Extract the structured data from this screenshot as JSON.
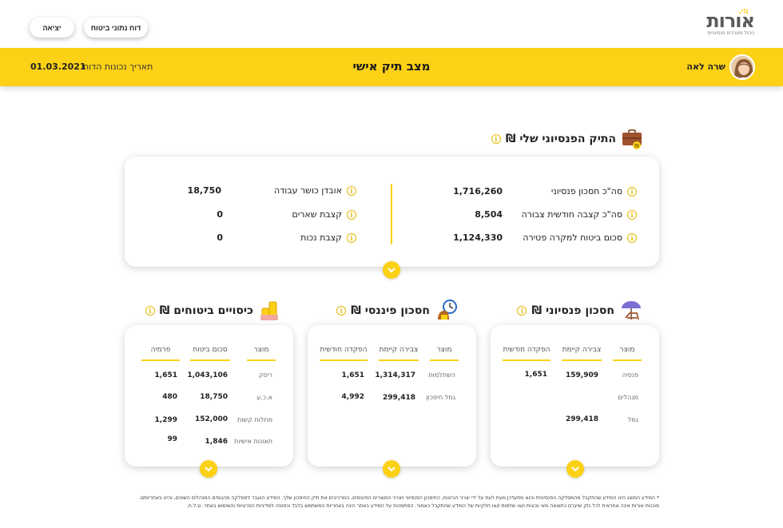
{
  "brand": {
    "name": "אורות",
    "tagline": "ניהול מערכים פנסיוניים"
  },
  "header_buttons": {
    "insurance_report": "דוח נתוני ביטוח",
    "exit": "יציאה"
  },
  "hero": {
    "title": "מצב תיק אישי",
    "user_name": "שרה לאה",
    "date_label": "תאריך נכונות הדוח",
    "date_value": "01.03.2021"
  },
  "summary": {
    "title": "התיק הפנסיוני שלי ₪",
    "right": [
      {
        "label": "סה\"כ חסכון פנסיוני",
        "value": "1,716,260"
      },
      {
        "label": "סה\"כ קצבה חודשית צבורה",
        "value": "8,504"
      },
      {
        "label": "סכום ביטוח למקרה פטירה",
        "value": "1,124,330"
      }
    ],
    "left": [
      {
        "label": "אובדן כושר עבודה",
        "value": "18,750"
      },
      {
        "label": "קצבת שארים",
        "value": "0"
      },
      {
        "label": "קצבת נכות",
        "value": "0"
      }
    ]
  },
  "pension": {
    "title": "חסכון פנסיוני ₪",
    "headers": [
      "מוצר",
      "צבירה קיימת",
      "הפקדה חודשית"
    ],
    "rows": [
      {
        "product": "פנסיה",
        "balance": "159,909",
        "monthly": "1,651"
      },
      {
        "product": "מנהלים",
        "balance": "",
        "monthly": ""
      },
      {
        "product": "גמל",
        "balance": "299,418",
        "monthly": ""
      }
    ]
  },
  "financial": {
    "title": "חסכון פיננסי ₪",
    "headers": [
      "מוצר",
      "צבירה קיימת",
      "הפקדה חודשית"
    ],
    "rows": [
      {
        "product": "השתלמות",
        "balance": "1,314,317",
        "monthly": "1,651"
      },
      {
        "product": "גמל חיסכון",
        "balance": "299,418",
        "monthly": "4,992"
      }
    ]
  },
  "insurance": {
    "title": "כיסויים ביטוחים ₪",
    "headers": [
      "מוצר",
      "סכום ביטוח",
      "פרמיה"
    ],
    "rows": [
      {
        "product": "ריסק",
        "sum": "1,043,106",
        "premium": "1,651"
      },
      {
        "product": "א.כ.ע",
        "sum": "18,750",
        "premium": "480"
      },
      {
        "product": "מחלות קשות",
        "sum": "152,000",
        "premium": "1,299"
      },
      {
        "product": "תאונות אישיות",
        "sum": "1,846",
        "premium": "99"
      }
    ]
  },
  "footnote": "* המידע המוצג הינו המידע שהתקבל מהמסלקה הפנסיונית והוא מתעדכן מעת לעת על ידי יצרני הביטוח, החיסכון הפנסיוני ויצרני המוצרים הפיננסים, המרכיבים את תיק החיסכון שלך. המידע הועבר למסלקה מהגופים המנהלים השונים, והינו באחריותם. סוכנות אורות אינה אחראית לכל נזק שייגרם כתוצאה מאי נכונות ו/או שלמות ו/או חלקיות של המידע שהתקבל כאמור. הסתמכות על המידע באתר הינה באחריות המשתמש בלבד וכפופה למדיניות הפרטיות והשימוש באתר. ט.ל.ח.",
  "colors": {
    "accent": "#fcd116",
    "text": "#1a1a1a"
  },
  "icons": [
    "logo-rays-icon",
    "briefcase-icon",
    "umbrella-chair-icon",
    "money-clock-icon",
    "coins-icon",
    "info-icon",
    "chevron-down-icon"
  ]
}
